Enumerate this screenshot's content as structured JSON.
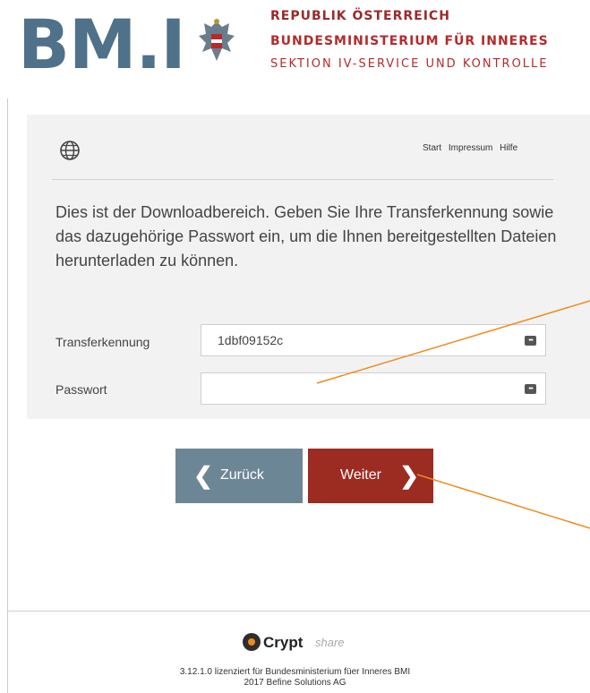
{
  "header": {
    "logo_text": "BM.I",
    "line1": "REPUBLIK ÖSTERREICH",
    "line2": "BUNDESMINISTERIUM FÜR INNERES",
    "line3": "SEKTION IV-SERVICE UND KONTROLLE"
  },
  "nav": {
    "links": [
      "Start",
      "Impressum",
      "Hilfe"
    ]
  },
  "intro_text": "Dies ist der Downloadbereich. Geben Sie Ihre Transferkennung sowie das dazugehörige Passwort ein, um die Ihnen bereitgestellten Dateien herunterladen zu können.",
  "form": {
    "transfer_label": "Transferkennung",
    "transfer_value": "1dbf09152c",
    "password_label": "Passwort",
    "password_value": ""
  },
  "buttons": {
    "back_label": "Zurück",
    "next_label": "Weiter"
  },
  "footer": {
    "brand_name": "Crypt",
    "brand_suffix": "share",
    "license_line": "3.12.1.0 lizenziert für Bundesministerium füer Inneres BMI",
    "copyright_line": "2017 Befine Solutions AG"
  },
  "colors": {
    "logo_blue": "#4f7189",
    "header_red": "#b52a2a",
    "back_button": "#6d8696",
    "next_button": "#9c2b22",
    "annotation": "#f08a1c"
  },
  "icons": [
    "eagle-emblem-icon",
    "globe-icon",
    "key-icon",
    "chevron-left-icon",
    "chevron-right-icon",
    "cryptshare-logo-icon"
  ]
}
